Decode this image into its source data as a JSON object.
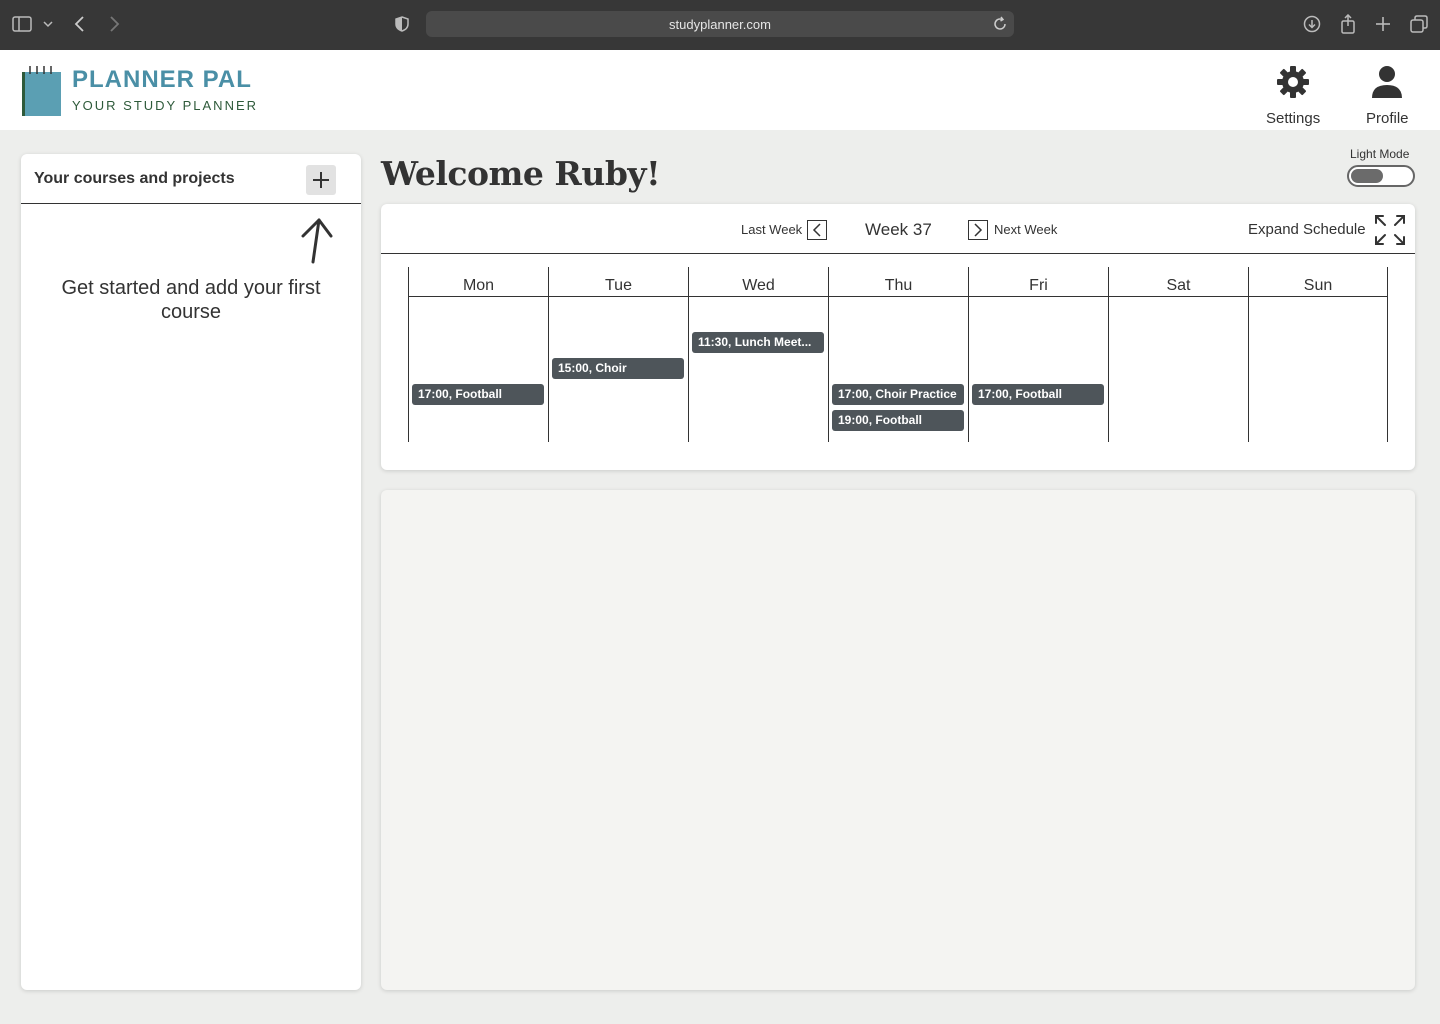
{
  "browser": {
    "url": "studyplanner.com"
  },
  "header": {
    "brand_name": "PLANNER PAL",
    "brand_tagline": "YOUR STUDY PLANNER",
    "settings_label": "Settings",
    "profile_label": "Profile"
  },
  "sidebar": {
    "title": "Your courses and projects",
    "empty_message": "Get started and add your first course"
  },
  "main": {
    "welcome": "Welcome Ruby!",
    "mode_label": "Light Mode"
  },
  "schedule": {
    "last_week_label": "Last Week",
    "week_label": "Week 37",
    "next_week_label": "Next Week",
    "expand_label": "Expand Schedule",
    "days": [
      {
        "name": "Mon",
        "events": [
          "17:00, Football"
        ]
      },
      {
        "name": "Tue",
        "events": [
          "15:00, Choir"
        ]
      },
      {
        "name": "Wed",
        "events": [
          "11:30, Lunch Meet..."
        ]
      },
      {
        "name": "Thu",
        "events": [
          "17:00, Choir Practice",
          "19:00, Football"
        ]
      },
      {
        "name": "Fri",
        "events": [
          "17:00, Football"
        ]
      },
      {
        "name": "Sat",
        "events": []
      },
      {
        "name": "Sun",
        "events": []
      }
    ]
  },
  "colors": {
    "brand": "#4a8fa6",
    "event_bg": "#4e555a",
    "page_bg": "#edeeec"
  }
}
